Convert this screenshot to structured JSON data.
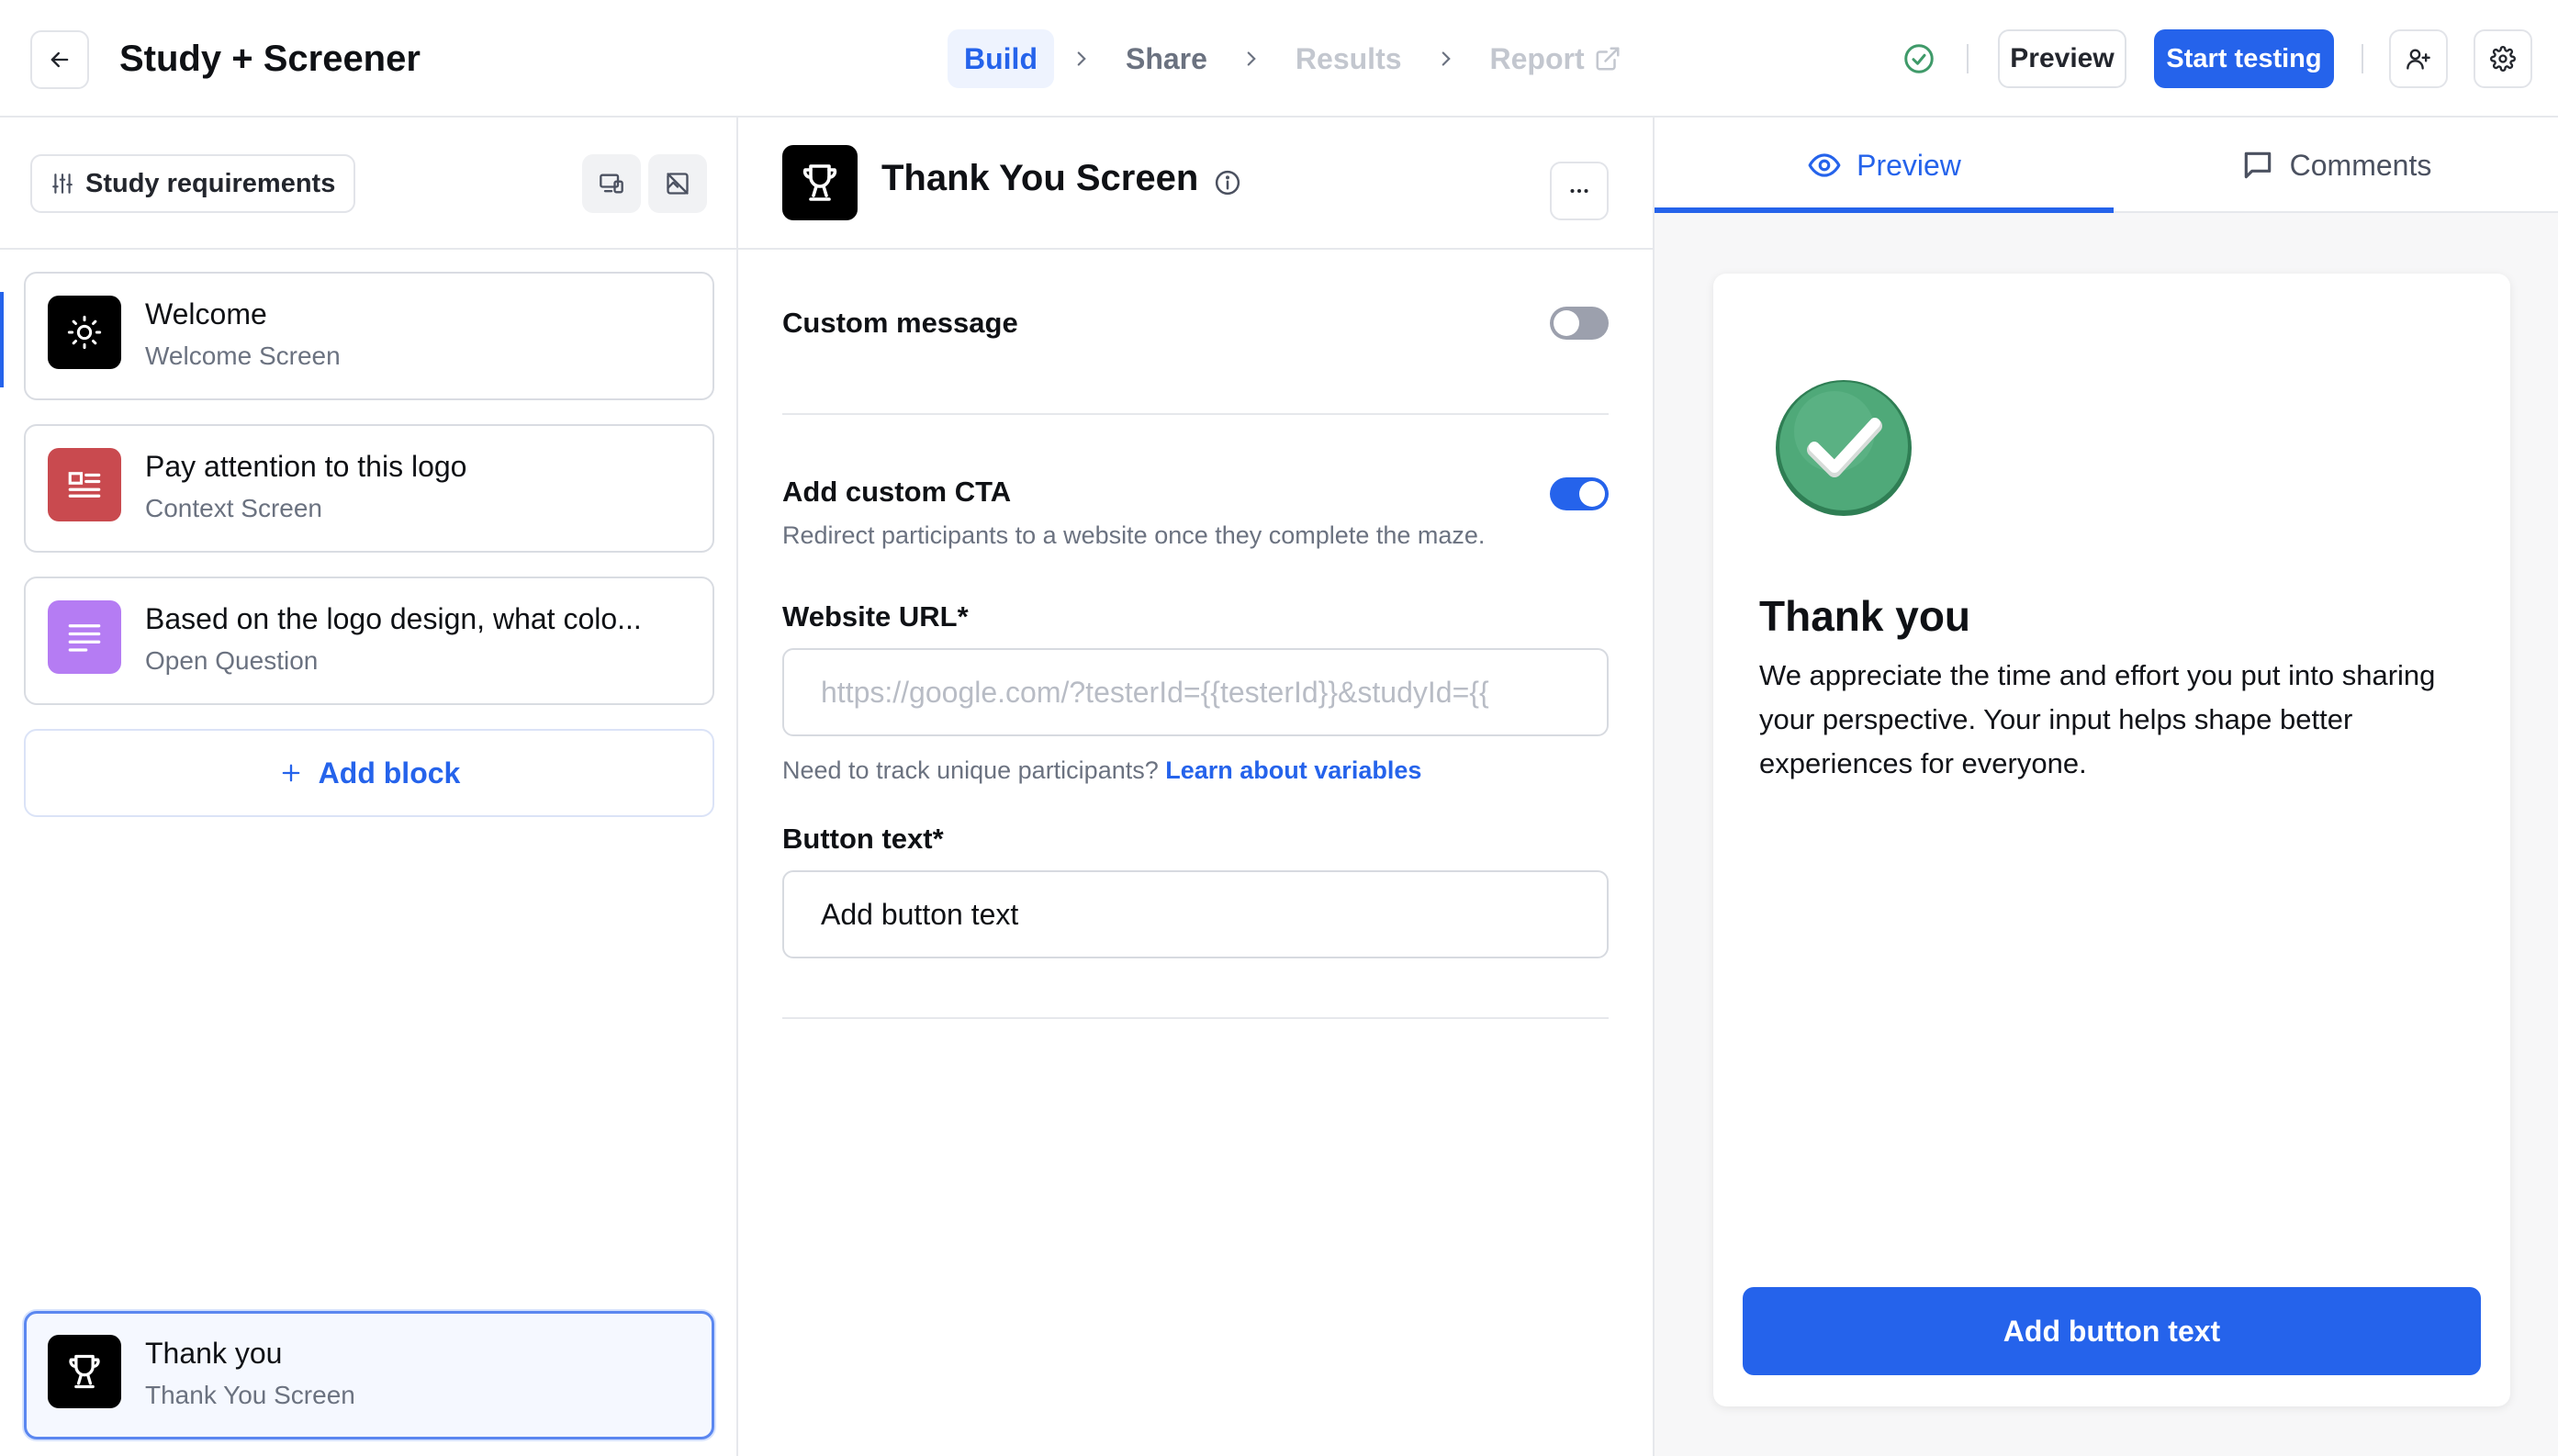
{
  "header": {
    "title": "Study + Screener",
    "steps": [
      {
        "label": "Build"
      },
      {
        "label": "Share"
      },
      {
        "label": "Results"
      },
      {
        "label": "Report"
      }
    ],
    "preview_label": "Preview",
    "start_label": "Start testing"
  },
  "sidebar": {
    "requirements_label": "Study requirements",
    "blocks": [
      {
        "title": "Welcome",
        "subtitle": "Welcome Screen",
        "icon": "sun-icon",
        "color": "#000000"
      },
      {
        "title": "Pay attention to this logo",
        "subtitle": "Context Screen",
        "icon": "newspaper-icon",
        "color": "#c94a4f"
      },
      {
        "title": "Based on the logo design, what colo...",
        "subtitle": "Open Question",
        "icon": "text-lines-icon",
        "color": "#b57cf3"
      }
    ],
    "add_block_label": "Add block",
    "selected_block": {
      "title": "Thank you",
      "subtitle": "Thank You Screen",
      "icon": "trophy-icon",
      "color": "#000000"
    }
  },
  "editor": {
    "title": "Thank You Screen",
    "custom_message_label": "Custom message",
    "custom_message_enabled": false,
    "custom_cta_label": "Add custom CTA",
    "custom_cta_enabled": true,
    "custom_cta_help": "Redirect participants to a website once they complete the maze.",
    "website_url_label": "Website URL*",
    "website_url_placeholder": "https://google.com/?testerId={{testerId}}&studyId={{",
    "website_url_value": "",
    "variables_help": "Need to track unique participants?",
    "variables_link": "Learn about variables",
    "button_text_label": "Button text*",
    "button_text_value": "Add button text"
  },
  "preview_panel": {
    "tabs": [
      {
        "label": "Preview",
        "icon": "eye-icon"
      },
      {
        "label": "Comments",
        "icon": "comment-icon"
      }
    ],
    "card": {
      "title": "Thank you",
      "body": "We appreciate the time and effort you put into sharing your perspective. Your input helps shape better experiences for everyone.",
      "button_label": "Add button text"
    }
  },
  "colors": {
    "accent": "#2563eb",
    "success": "#3f9a69"
  }
}
